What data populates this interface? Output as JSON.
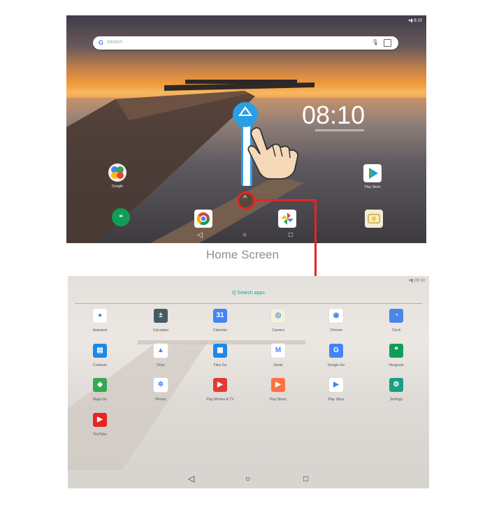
{
  "home": {
    "search_placeholder": "Search",
    "clock": "08:10",
    "apps": [
      {
        "label": "Google",
        "icon": "google-folder-icon"
      },
      {
        "label": "Play Store",
        "icon": "play-store-icon"
      },
      {
        "label": "Hangouts",
        "icon": "hangouts-icon"
      },
      {
        "label": "Chrome",
        "icon": "chrome-icon"
      },
      {
        "label": "Photos",
        "icon": "photos-icon"
      },
      {
        "label": "Camera",
        "icon": "camera-icon"
      }
    ],
    "nav": {
      "back": "◁",
      "home": "○",
      "recents": "□"
    }
  },
  "caption": "Home Screen",
  "drawer": {
    "search_label": "Q  Search apps",
    "apps": [
      {
        "label": "Assistant",
        "color": "#ffffff",
        "glyph": "●"
      },
      {
        "label": "Calculator",
        "color": "#455a64",
        "glyph": "±"
      },
      {
        "label": "Calendar",
        "color": "#4285F4",
        "glyph": "31"
      },
      {
        "label": "Camera",
        "color": "#f4f0d8",
        "glyph": "◎"
      },
      {
        "label": "Chrome",
        "color": "#ffffff",
        "glyph": "◉"
      },
      {
        "label": "Clock",
        "color": "#4a86e8",
        "glyph": "◔"
      },
      {
        "label": "Contacts",
        "color": "#1e88e5",
        "glyph": "▤"
      },
      {
        "label": "Drive",
        "color": "#ffffff",
        "glyph": "▲"
      },
      {
        "label": "Files Go",
        "color": "#1e88e5",
        "glyph": "▦"
      },
      {
        "label": "Gmail",
        "color": "#ffffff",
        "glyph": "M"
      },
      {
        "label": "Google Go",
        "color": "#4285F4",
        "glyph": "G"
      },
      {
        "label": "Hangouts",
        "color": "#0f9d58",
        "glyph": "❝"
      },
      {
        "label": "Maps Go",
        "color": "#34a853",
        "glyph": "◆"
      },
      {
        "label": "Photos",
        "color": "#ffffff",
        "glyph": "✲"
      },
      {
        "label": "Play Movies & TV",
        "color": "#e53935",
        "glyph": "▶"
      },
      {
        "label": "Play Music",
        "color": "#ff7043",
        "glyph": "▶"
      },
      {
        "label": "Play Store",
        "color": "#ffffff",
        "glyph": "▶"
      },
      {
        "label": "Settings",
        "color": "#1a9e87",
        "glyph": "⚙"
      },
      {
        "label": "YouTube",
        "color": "#e52525",
        "glyph": "▶"
      }
    ],
    "nav": {
      "back": "◁",
      "home": "○",
      "recents": "□"
    }
  }
}
